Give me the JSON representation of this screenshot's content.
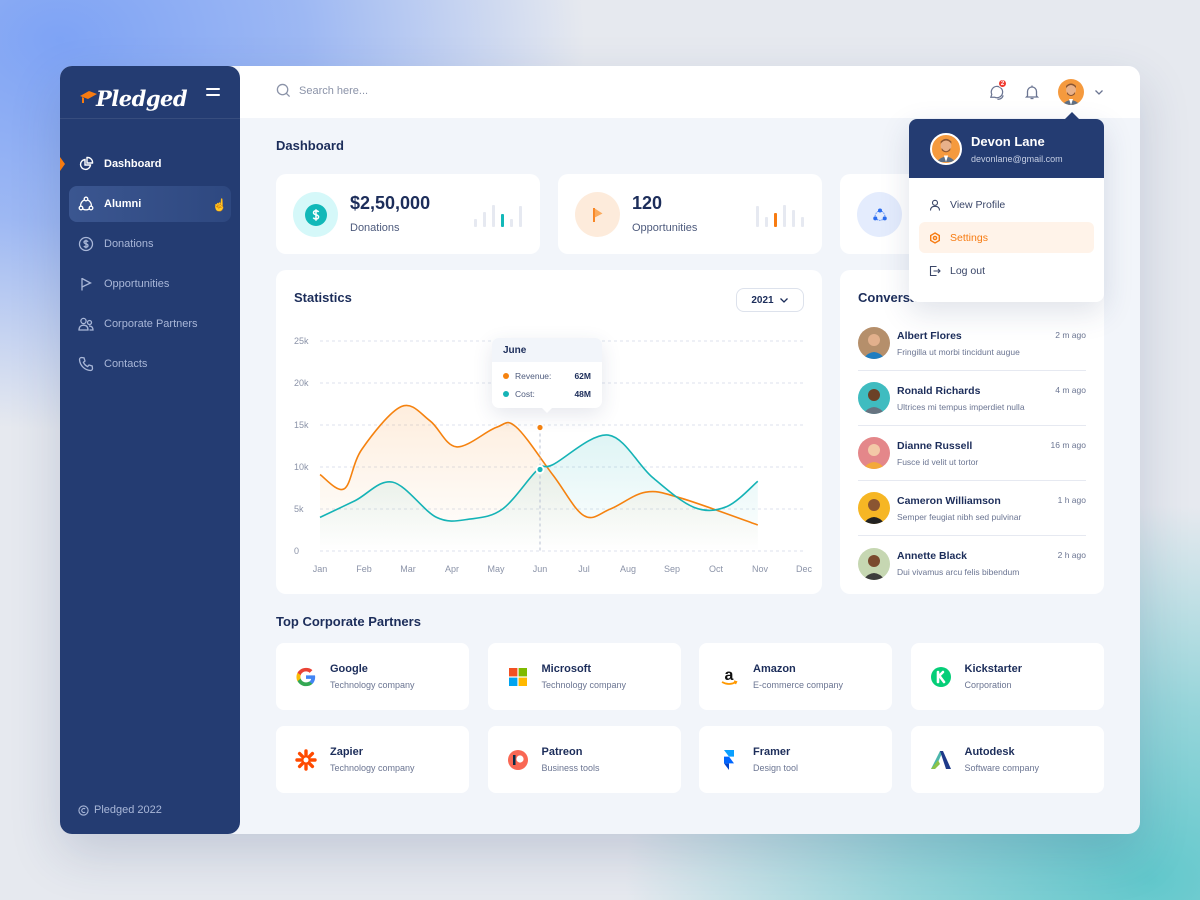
{
  "brand": {
    "name": "Pledged",
    "accent": "#f77b11",
    "navy": "#243c72"
  },
  "sidebar": {
    "items": [
      {
        "label": "Dashboard",
        "icon": "pie-chart-icon",
        "state": "active"
      },
      {
        "label": "Alumni",
        "icon": "alumni-network-icon",
        "state": "hover"
      },
      {
        "label": "Donations",
        "icon": "dollar-circle-icon",
        "state": "default"
      },
      {
        "label": "Opportunities",
        "icon": "flag-icon",
        "state": "default"
      },
      {
        "label": "Corporate Partners",
        "icon": "users-icon",
        "state": "default"
      },
      {
        "label": "Contacts",
        "icon": "phone-icon",
        "state": "default"
      }
    ],
    "footer": "Pledged 2022"
  },
  "topbar": {
    "search_placeholder": "Search here...",
    "chat_badge": "2"
  },
  "user": {
    "name": "Devon Lane",
    "email": "devonlane@gmail.com"
  },
  "dropdown": {
    "items": [
      {
        "label": "View Profile",
        "icon": "user-icon"
      },
      {
        "label": "Settings",
        "icon": "settings-icon",
        "active": true
      },
      {
        "label": "Log out",
        "icon": "logout-icon"
      }
    ]
  },
  "page": {
    "title": "Dashboard"
  },
  "stats": [
    {
      "value": "$2,50,000",
      "label": "Donations",
      "icon": "dollar-icon",
      "bars": [
        0.35,
        0.7,
        1.0,
        0.6,
        0.35,
        0.95
      ],
      "highlight": 3,
      "color": "#12b8b8",
      "bg": "#d5f8f9"
    },
    {
      "value": "120",
      "label": "Opportunities",
      "icon": "flag-icon",
      "bars": [
        0.95,
        0.45,
        0.65,
        1.0,
        0.75,
        0.45
      ],
      "highlight": 2,
      "color": "#f77b11",
      "bg": "#fdebdb"
    },
    {
      "value": "",
      "label": "",
      "icon": "alumni-network-icon",
      "color": "#2b6df0",
      "bg": "#e4ecfd"
    }
  ],
  "statistics": {
    "title": "Statistics",
    "year": "2021",
    "tooltip": {
      "month": "June",
      "rows": [
        {
          "label": "Revenue:",
          "value": "62M"
        },
        {
          "label": "Cost:",
          "value": "48M"
        }
      ]
    }
  },
  "chart_data": {
    "type": "area",
    "title": "Statistics",
    "categories": [
      "Jan",
      "Feb",
      "Mar",
      "Apr",
      "May",
      "Jun",
      "Jul",
      "Aug",
      "Sep",
      "Oct",
      "Nov",
      "Dec"
    ],
    "x_points": [
      0,
      0.5,
      1,
      1.5,
      2,
      2.5,
      3,
      3.5,
      4,
      4.5,
      5,
      5.5,
      6,
      6.5,
      7,
      7.5,
      8,
      8.5,
      9,
      9.5,
      10,
      10.5,
      11
    ],
    "series": [
      {
        "name": "Revenue",
        "color": "#f5820f",
        "values": [
          9100,
          7400,
          12100,
          17200,
          15500,
          12400,
          14700,
          14800,
          9000,
          4200,
          5000,
          7000,
          6300,
          3100
        ],
        "x": [
          0,
          0.55,
          0.95,
          1.85,
          2.5,
          3.1,
          4.0,
          4.45,
          5.3,
          6.0,
          6.6,
          7.4,
          8.2,
          9.95
        ]
      },
      {
        "name": "Cost",
        "color": "#15b3b6",
        "values": [
          4000,
          6000,
          8200,
          4000,
          3800,
          5000,
          9700,
          10300,
          13800,
          8800,
          5200,
          5300,
          8300
        ],
        "x": [
          0,
          0.8,
          1.65,
          2.65,
          3.4,
          4.15,
          4.95,
          5.3,
          6.55,
          7.55,
          8.5,
          9.25,
          9.95
        ]
      }
    ],
    "yticks": [
      "0",
      "5k",
      "10k",
      "15k",
      "20k",
      "25k"
    ],
    "ylim": [
      0,
      25000
    ],
    "grid": true,
    "highlight": {
      "month": "Jun",
      "revenue": 14700,
      "cost": 9700
    }
  },
  "conversations": {
    "title": "Conversations",
    "items": [
      {
        "name": "Albert Flores",
        "message": "Fringilla ut morbi tincidunt augue",
        "time": "2 m ago",
        "bg": "#b58f6b",
        "skin": "#e2b08c",
        "shirt": "#1e7dc0"
      },
      {
        "name": "Ronald Richards",
        "message": "Ultrices mi tempus imperdiet nulla",
        "time": "4 m ago",
        "bg": "#3fbcc0",
        "skin": "#6b4127",
        "shirt": "#677380"
      },
      {
        "name": "Dianne Russell",
        "message": "Fusce id velit ut tortor",
        "time": "16 m ago",
        "bg": "#e4878a",
        "skin": "#f3c9a7",
        "shirt": "#f3a93a"
      },
      {
        "name": "Cameron Williamson",
        "message": "Semper feugiat nibh sed pulvinar",
        "time": "1 h ago",
        "bg": "#f6b624",
        "skin": "#8a5532",
        "shirt": "#222"
      },
      {
        "name": "Annette Black",
        "message": "Dui vivamus arcu felis bibendum",
        "time": "2 h ago",
        "bg": "#c6d7b2",
        "skin": "#7a4a2e",
        "shirt": "#3c3c3c"
      }
    ]
  },
  "partners": {
    "title": "Top Corporate Partners",
    "items": [
      {
        "name": "Google",
        "type": "Technology company",
        "logo": "google-logo"
      },
      {
        "name": "Microsoft",
        "type": "Technology company",
        "logo": "microsoft-logo"
      },
      {
        "name": "Amazon",
        "type": "E-commerce company",
        "logo": "amazon-logo"
      },
      {
        "name": "Kickstarter",
        "type": "Corporation",
        "logo": "kickstarter-logo"
      },
      {
        "name": "Zapier",
        "type": "Technology company",
        "logo": "zapier-logo"
      },
      {
        "name": "Patreon",
        "type": "Business tools",
        "logo": "patreon-logo"
      },
      {
        "name": "Framer",
        "type": "Design tool",
        "logo": "framer-logo"
      },
      {
        "name": "Autodesk",
        "type": "Software company",
        "logo": "autodesk-logo"
      }
    ]
  }
}
